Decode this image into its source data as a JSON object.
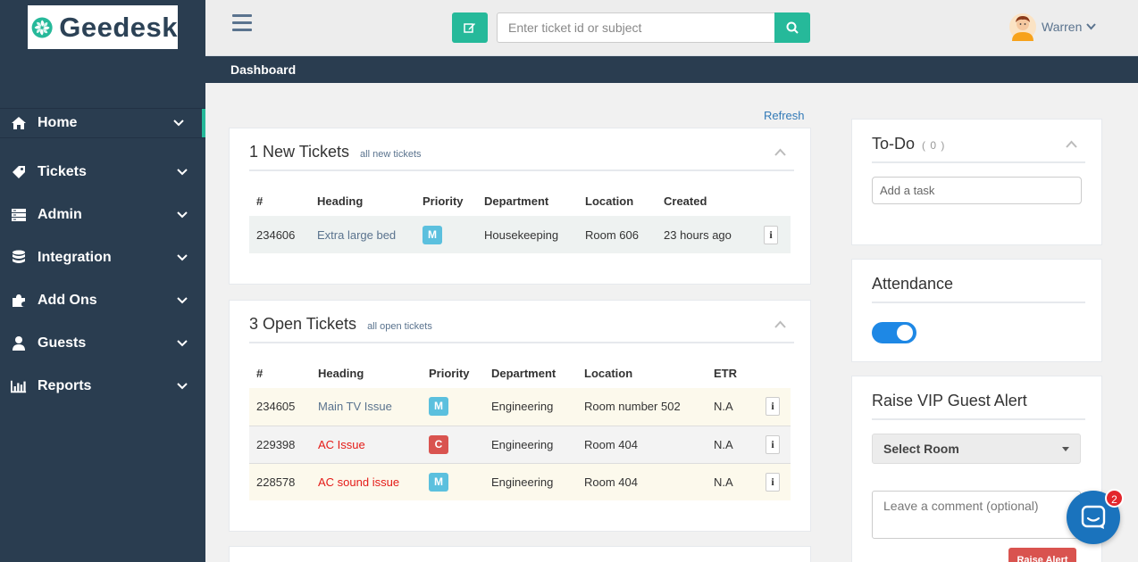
{
  "brand": {
    "name": "Geedesk",
    "accent": "#26b99a",
    "sidebar_bg": "#2a3d50"
  },
  "sidebar": {
    "items": [
      {
        "label": "Home",
        "icon": "home-icon"
      },
      {
        "label": "Tickets",
        "icon": "tag-icon"
      },
      {
        "label": "Admin",
        "icon": "server-icon"
      },
      {
        "label": "Integration",
        "icon": "database-icon"
      },
      {
        "label": "Add Ons",
        "icon": "puzzle-icon"
      },
      {
        "label": "Guests",
        "icon": "user-icon"
      },
      {
        "label": "Reports",
        "icon": "bar-chart-icon"
      }
    ]
  },
  "topbar": {
    "search_placeholder": "Enter ticket id or subject",
    "user_name": "Warren"
  },
  "breadcrumb": "Dashboard",
  "refresh_label": "Refresh",
  "new_tickets": {
    "title": "1 New Tickets",
    "link": "all new tickets",
    "columns": [
      "#",
      "Heading",
      "Priority",
      "Department",
      "Location",
      "Created"
    ],
    "rows": [
      {
        "id": "234606",
        "heading": "Extra large bed",
        "priority": "M",
        "department": "Housekeeping",
        "location": "Room 606",
        "created": "23 hours ago"
      }
    ]
  },
  "open_tickets": {
    "title": "3 Open Tickets",
    "link": "all open tickets",
    "columns": [
      "#",
      "Heading",
      "Priority",
      "Department",
      "Location",
      "ETR"
    ],
    "rows": [
      {
        "id": "234605",
        "heading": "Main TV Issue",
        "priority": "M",
        "department": "Engineering",
        "location": "Room number 502",
        "etr": "N.A"
      },
      {
        "id": "229398",
        "heading": "AC Issue",
        "priority": "C",
        "department": "Engineering",
        "location": "Room 404",
        "etr": "N.A"
      },
      {
        "id": "228578",
        "heading": "AC sound issue",
        "priority": "M",
        "department": "Engineering",
        "location": "Room 404",
        "etr": "N.A"
      }
    ]
  },
  "info_glyph": "i",
  "todo": {
    "title": "To-Do",
    "count": "( 0 )",
    "placeholder": "Add a task"
  },
  "attendance": {
    "title": "Attendance",
    "toggle_on": true
  },
  "vip_alert": {
    "title": "Raise VIP Guest Alert",
    "select_value": "Select Room",
    "comment_placeholder": "Leave a comment (optional)",
    "button_label": "Raise Alert"
  },
  "chat": {
    "unread": "2"
  }
}
